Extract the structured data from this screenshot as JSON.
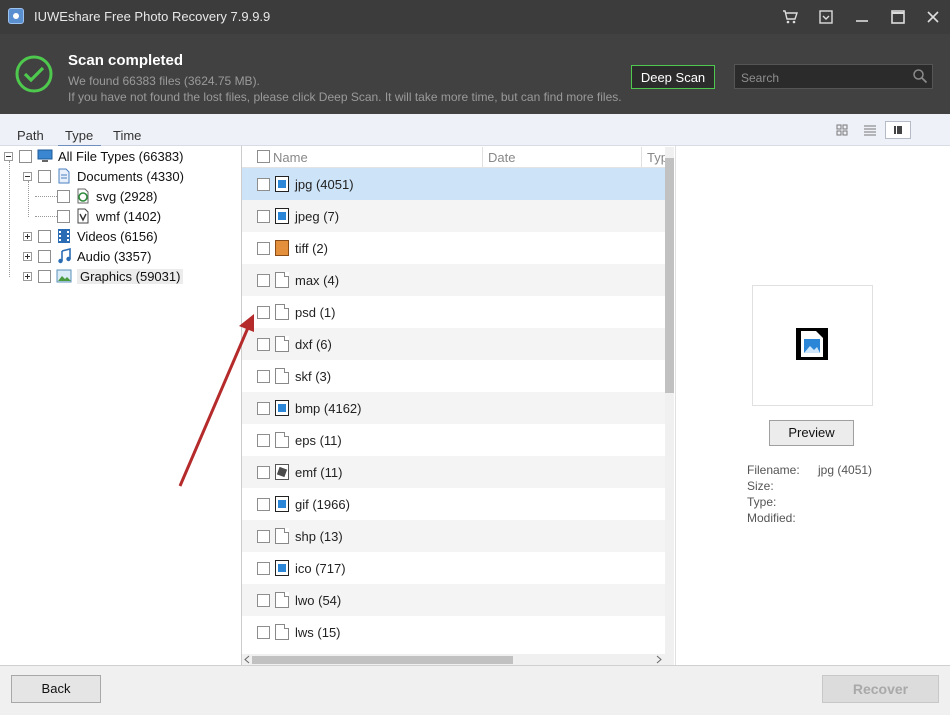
{
  "window": {
    "title": "IUWEshare Free Photo Recovery 7.9.9.9",
    "controls": [
      "cart-icon",
      "minimize-to-tray-icon",
      "minimize-icon",
      "maximize-icon",
      "close-icon"
    ]
  },
  "header": {
    "status_title": "Scan completed",
    "found_text": "We found 66383 files (3624.75 MB).",
    "hint_text": "If you have not found the lost files, please click Deep Scan. It will take more time, but can find more files.",
    "deep_scan_label": "Deep Scan",
    "search_placeholder": "Search",
    "accent_color": "#4ec94e"
  },
  "tabs": [
    {
      "label": "Path"
    },
    {
      "label": "Type",
      "active": true
    },
    {
      "label": "Time"
    }
  ],
  "tree": {
    "root": {
      "label": "All File Types (66383)"
    },
    "items": [
      {
        "label": "Documents (4330)"
      },
      {
        "label": "svg (2928)"
      },
      {
        "label": "wmf (1402)"
      },
      {
        "label": "Videos (6156)"
      },
      {
        "label": "Audio (3357)"
      },
      {
        "label": "Graphics (59031)",
        "selected": true
      }
    ]
  },
  "list": {
    "columns": [
      "Name",
      "Date",
      "Typ"
    ],
    "rows": [
      {
        "name": "jpg (4051)",
        "icon": "image-file-icon",
        "selected": true
      },
      {
        "name": "jpeg (7)",
        "icon": "image-file-icon"
      },
      {
        "name": "tiff (2)",
        "icon": "tiff-file-icon"
      },
      {
        "name": "max (4)",
        "icon": "blank-file-icon"
      },
      {
        "name": "psd (1)",
        "icon": "blank-file-icon"
      },
      {
        "name": "dxf (6)",
        "icon": "blank-file-icon"
      },
      {
        "name": "skf (3)",
        "icon": "blank-file-icon"
      },
      {
        "name": "bmp (4162)",
        "icon": "image-file-icon"
      },
      {
        "name": "eps (11)",
        "icon": "blank-file-icon"
      },
      {
        "name": "emf (11)",
        "icon": "emf-file-icon"
      },
      {
        "name": "gif (1966)",
        "icon": "image-file-icon"
      },
      {
        "name": "shp (13)",
        "icon": "blank-file-icon"
      },
      {
        "name": "ico (717)",
        "icon": "image-file-icon"
      },
      {
        "name": "lwo (54)",
        "icon": "blank-file-icon"
      },
      {
        "name": "lws (15)",
        "icon": "blank-file-icon"
      }
    ]
  },
  "preview": {
    "button_label": "Preview",
    "labels": {
      "filename": "Filename:",
      "size": "Size:",
      "type": "Type:",
      "modified": "Modified:"
    },
    "values": {
      "filename": "jpg (4051)",
      "size": "",
      "type": "",
      "modified": ""
    }
  },
  "footer": {
    "back_label": "Back",
    "recover_label": "Recover"
  }
}
